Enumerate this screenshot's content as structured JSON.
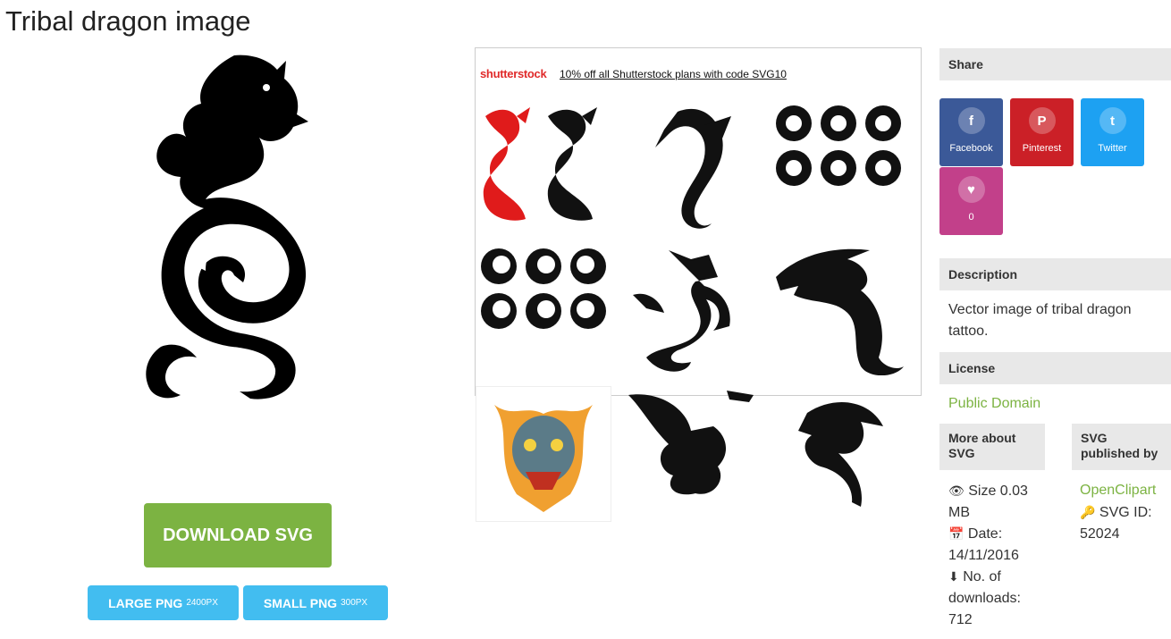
{
  "page": {
    "title": "Tribal dragon image"
  },
  "download": {
    "svg_label": "DOWNLOAD SVG",
    "large_png_label": "LARGE PNG",
    "large_png_size": "2400PX",
    "small_png_label": "SMALL PNG",
    "small_png_size": "300PX"
  },
  "ad": {
    "logo_text": "shutterstock",
    "promo_link": "10% off all Shutterstock plans with code SVG10"
  },
  "sidebar": {
    "share_heading": "Share",
    "share_buttons": [
      {
        "label": "Facebook",
        "color": "#3b5998",
        "icon": "facebook-icon"
      },
      {
        "label": "Pinterest",
        "color": "#cb2027",
        "icon": "pinterest-icon"
      },
      {
        "label": "Twitter",
        "color": "#1da1f2",
        "icon": "twitter-icon"
      }
    ],
    "likes": {
      "count": "0",
      "color": "#c2408a",
      "icon": "heart-icon"
    },
    "description_heading": "Description",
    "description": "Vector image of tribal dragon tattoo.",
    "license_heading": "License",
    "license": "Public Domain",
    "more_heading": "More about SVG",
    "size_label": "Size 0.03 MB",
    "date_label": "Date:",
    "date_value": "14/11/2016",
    "downloads_label": "No. of downloads:",
    "downloads_value": "712",
    "published_heading": "SVG published by",
    "publisher": "OpenClipart",
    "svg_id_label": "SVG ID:",
    "svg_id_value": "52024"
  },
  "colors": {
    "accent_green": "#7cb342",
    "png_blue": "#42bdf0"
  }
}
